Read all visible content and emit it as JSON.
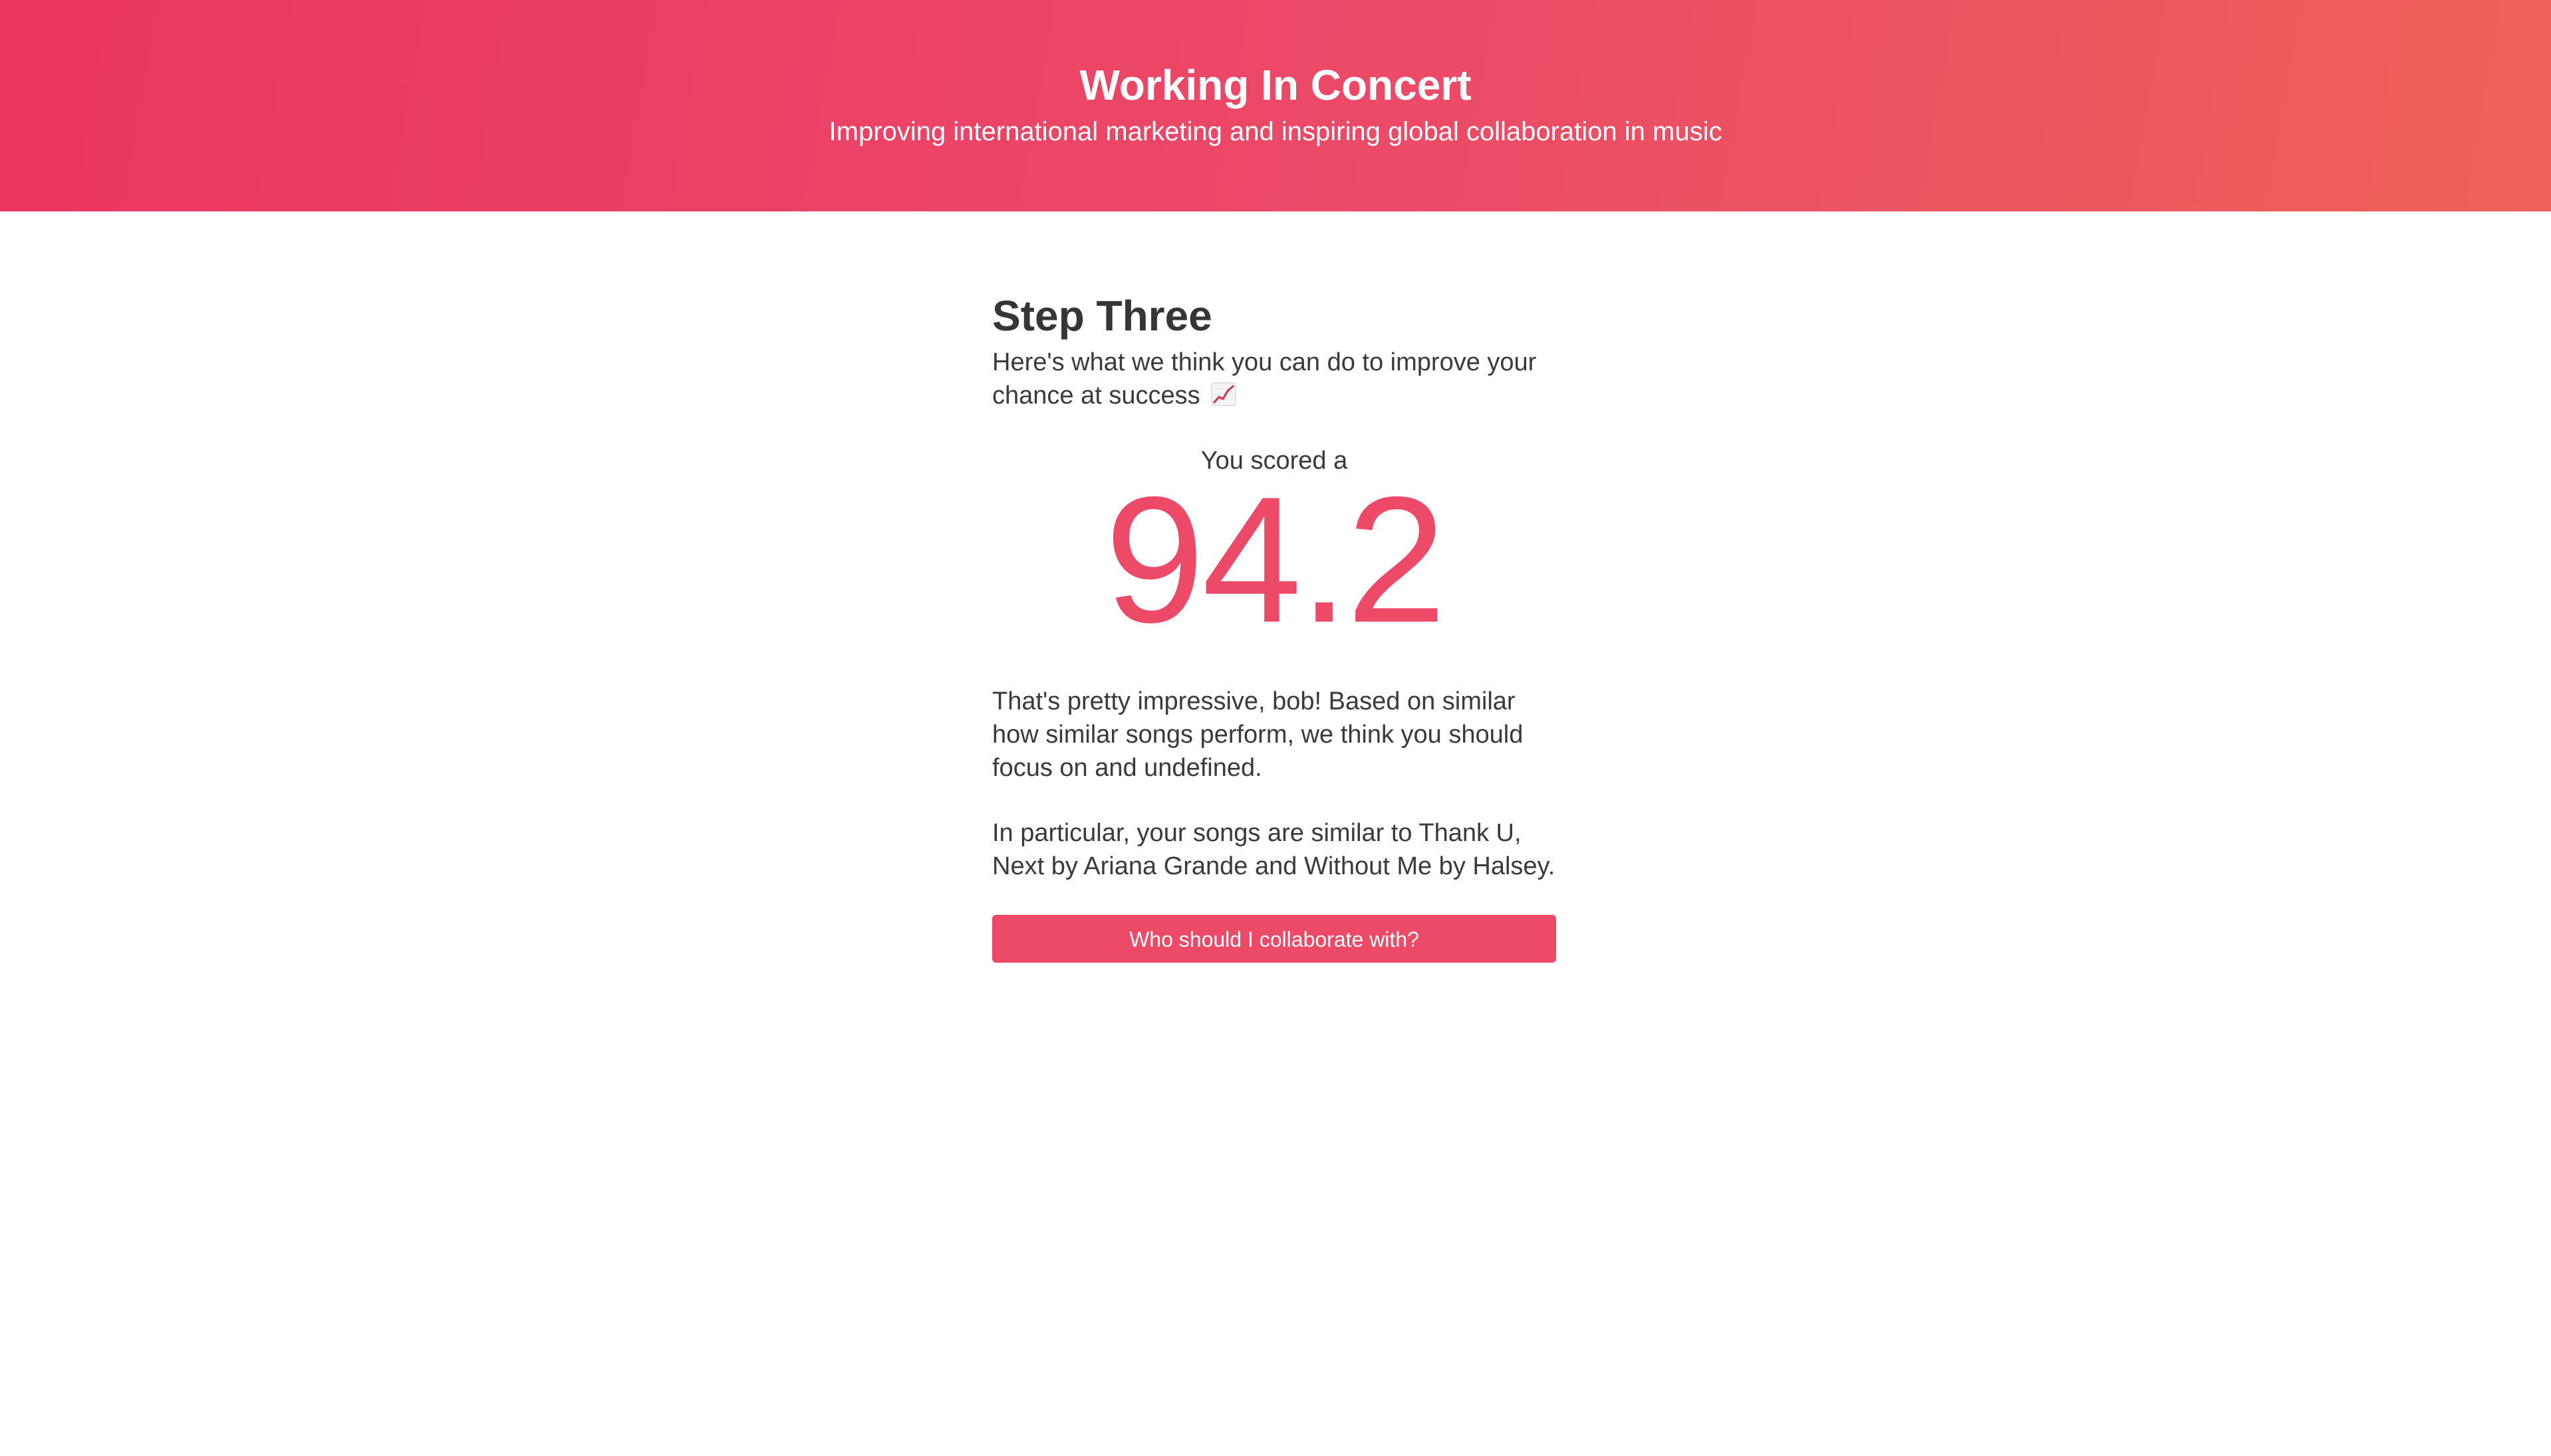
{
  "hero": {
    "title": "Working In Concert",
    "subtitle": "Improving international marketing and inspiring global collaboration in music"
  },
  "step": {
    "title": "Step Three",
    "description": "Here's what we think you can do to improve your chance at success",
    "icon": "chart-increasing-icon"
  },
  "score": {
    "label": "You scored a",
    "value": "94.2"
  },
  "results": {
    "paragraph1": "That's pretty impressive, bob! Based on similar how similar songs perform, we think you should focus on and undefined.",
    "paragraph2": "In particular, your songs are similar to Thank U, Next by Ariana Grande and Without Me by Halsey."
  },
  "cta": {
    "label": "Who should I collaborate with?"
  },
  "colors": {
    "accent": "#ec4a67",
    "gradient_start": "#eb3563",
    "gradient_end": "#ee6159",
    "text": "#3a3a3a"
  }
}
